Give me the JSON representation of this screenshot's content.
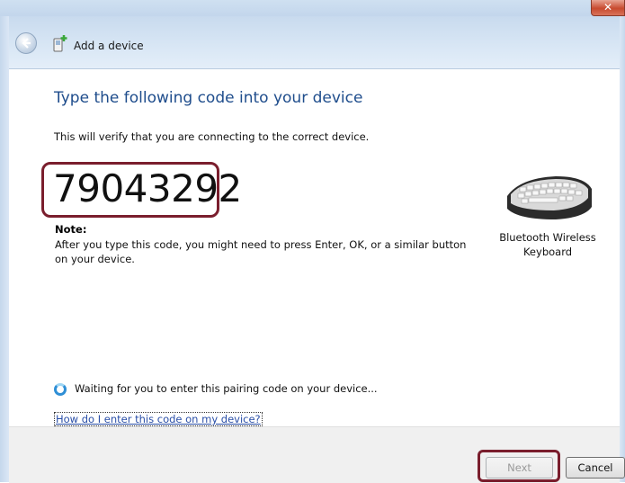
{
  "window": {
    "title": "Add a device",
    "close_glyph": "✕"
  },
  "main": {
    "heading": "Type the following code into your device",
    "description": "This will verify that you are connecting to the correct device.",
    "pairing_code": "79043292",
    "note_label": "Note:",
    "note_text": "After you type this code, you might need to press Enter, OK, or a similar button on your device.",
    "device_name": "Bluetooth Wireless Keyboard",
    "waiting_text": "Waiting for you to enter this pairing code on your device...",
    "help_link": "How do I enter this code on my device?"
  },
  "buttons": {
    "next": "Next",
    "cancel": "Cancel"
  },
  "colors": {
    "heading": "#1f4d8c",
    "highlight": "#7a1e2d",
    "link": "#2a4fa8"
  }
}
